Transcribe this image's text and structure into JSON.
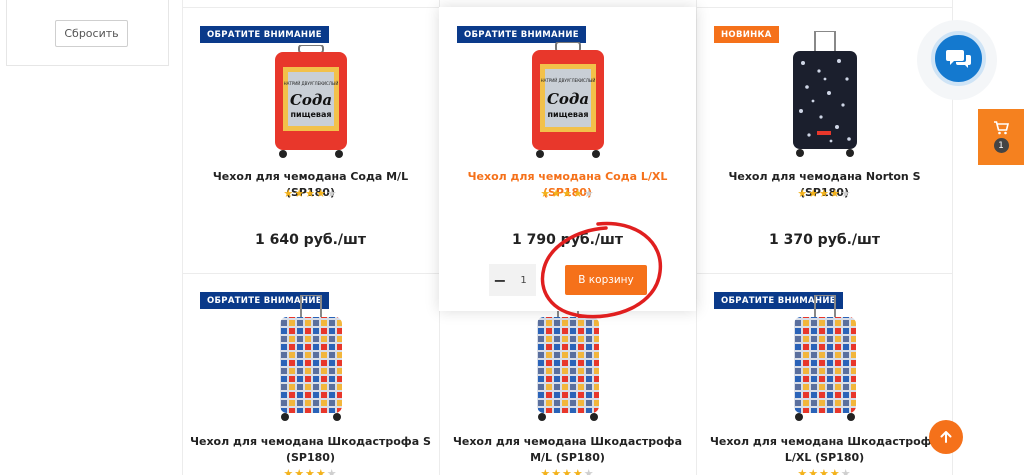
{
  "filters": {
    "reset_label": "Сбросить"
  },
  "products": [
    {
      "badge": "ОБРАТИТЕ ВНИМАНИЕ",
      "title": "Чехол для чемодана Сода M/L (SP180)",
      "rating": 4,
      "price": "1 640 руб./шт"
    },
    {
      "badge": "ОБРАТИТЕ ВНИМАНИЕ",
      "title": "Чехол для чемодана Сода L/XL (SP180)",
      "rating": 4,
      "price": "1 790 руб./шт",
      "quantity": "1",
      "add_to_cart": "В корзину"
    },
    {
      "badge": "НОВИНКА",
      "title": "Чехол для чемодана Norton S (SP180)",
      "rating": 4,
      "price": "1 370 руб./шт"
    },
    {
      "badge": "ОБРАТИТЕ ВНИМАНИЕ",
      "title": "Чехол для чемодана Шкодастрофа S (SP180)"
    },
    {
      "badge": "",
      "title": "Чехол для чемодана Шкодастрофа M/L (SP180)"
    },
    {
      "badge": "ОБРАТИТЕ ВНИМАНИЕ",
      "title": "Чехол для чемодана Шкодастрофа L/XL (SP180)"
    }
  ],
  "soda_print": {
    "small": "НАТРИЙ ДВУУГЛЕКИСЛЫЙ",
    "brand": "Сода",
    "sub": "пищевая"
  },
  "widgets": {
    "cart_count": "1",
    "chat_icon": "chat-bubbles-icon",
    "cart_icon": "cart-icon",
    "up_icon": "arrow-up-icon"
  },
  "colors": {
    "accent": "#f5711a",
    "badge_blue": "#0a3a8a",
    "chat_blue": "#1479cf",
    "star": "#f3b21c"
  }
}
